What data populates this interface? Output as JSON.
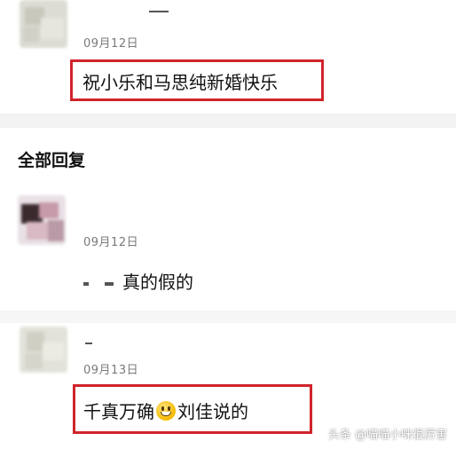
{
  "top_comment": {
    "date": "09月12日",
    "text": "祝小乐和马思纯新婚快乐"
  },
  "section": {
    "title": "全部回复"
  },
  "replies": [
    {
      "date": "09月12日",
      "text": "真的假的"
    },
    {
      "date": "09月13日",
      "text_before": "千真万确",
      "emoji": "grinning-face-emoji",
      "text_after": "刘佳说的"
    }
  ],
  "watermark": {
    "text": "头条 @喵喵小咪很厉害"
  },
  "colors": {
    "highlight_border": "#d0242b",
    "divider_band": "#f3f3f3",
    "date_text": "#7a7a7a"
  }
}
